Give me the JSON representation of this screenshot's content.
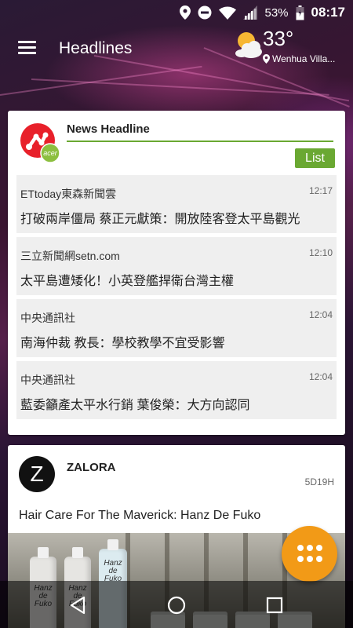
{
  "status_bar": {
    "battery_percent": "53%",
    "clock": "08:17",
    "icons": [
      "location-icon",
      "do-not-disturb-icon",
      "wifi-icon",
      "cellular-signal-icon",
      "battery-icon"
    ]
  },
  "app_bar": {
    "title": "Headlines",
    "menu_icon": "hamburger-menu-icon"
  },
  "weather": {
    "icon": "partly-cloudy-icon",
    "temperature": "33°",
    "location": "Wenhua Villa..."
  },
  "news_card": {
    "title": "News Headline",
    "logo": "acer-logo",
    "list_button": "List",
    "accent_color": "#6aa832",
    "items": [
      {
        "source": "ETtoday東森新聞雲",
        "time": "12:17",
        "headline": "打破兩岸僵局 蔡正元獻策：開放陸客登太平島觀光"
      },
      {
        "source": "三立新聞網setn.com",
        "time": "12:10",
        "headline": "太平島遭矮化！小英登艦捍衛台灣主權"
      },
      {
        "source": "中央通訊社",
        "time": "12:04",
        "headline": "南海仲裁 教長：學校教學不宜受影響"
      },
      {
        "source": "中央通訊社",
        "time": "12:04",
        "headline": "藍委籲產太平水行銷 葉俊榮：大方向認同"
      }
    ]
  },
  "zalora_card": {
    "logo_letter": "Z",
    "name": "ZALORA",
    "age": "5D19H",
    "headline": "Hair Care For The Maverick: Hanz De Fuko",
    "bottle_label_lines": [
      "Hanz",
      "de",
      "Fuko"
    ]
  },
  "fab": {
    "icon": "apps-grid-icon",
    "color": "#f29a17"
  },
  "nav_bar": {
    "icons": [
      "back-icon",
      "home-icon",
      "recents-icon"
    ]
  }
}
